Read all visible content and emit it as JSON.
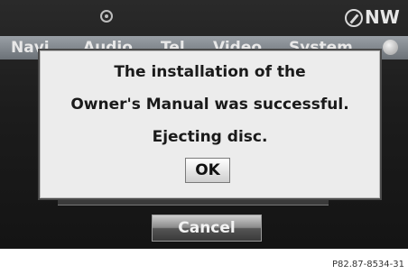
{
  "statusbar": {
    "disc_icon": "disc-icon",
    "compass_icon": "compass-icon",
    "compass_label": "NW"
  },
  "menu": {
    "items": [
      "Navi",
      "Audio",
      "Tel",
      "Video",
      "System"
    ],
    "end_icon": "round-knob-icon"
  },
  "dialog": {
    "lines": [
      "The installation of the",
      "Owner's Manual was successful.",
      "Ejecting disc."
    ],
    "ok_label": "OK"
  },
  "cancel_label": "Cancel",
  "figure_code": "P82.87-8534-31",
  "colors": {
    "screen_bg": "#1c1c1c",
    "menubar": "#8a9096",
    "dialog_bg": "#ececec",
    "text_dark": "#1a1a1a"
  }
}
